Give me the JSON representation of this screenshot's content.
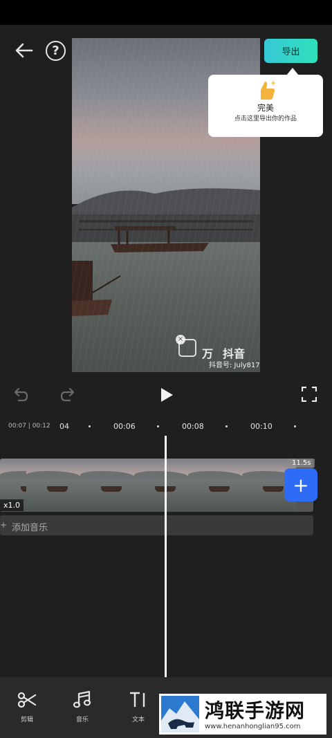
{
  "header": {
    "export_label": "导出",
    "tooltip_title": "完美",
    "tooltip_subtitle": "点击这里导出你的作品"
  },
  "preview": {
    "watermark_brand": "万",
    "watermark_logo": "抖音",
    "watermark_id": "抖音号: July817"
  },
  "ruler": {
    "time_readout": "00:07 | 00:12",
    "partial_tick": "04",
    "ticks": [
      "00:06",
      "00:08",
      "00:10"
    ]
  },
  "timeline": {
    "clip_speed": "x1.0",
    "clip_duration": "11.5s",
    "add_music_label": "添加音乐",
    "add_music_plus": "+"
  },
  "toolbar": {
    "tools": [
      {
        "label": "剪辑",
        "icon": "cut-icon"
      },
      {
        "label": "音乐",
        "icon": "music-icon"
      },
      {
        "label": "文本",
        "icon": "text-icon"
      }
    ]
  },
  "ad": {
    "title": "鸿联手游网",
    "url": "www.henanhonglian95.com"
  },
  "colors": {
    "accent": "#37c9d7",
    "add_button": "#2f6cf6",
    "background": "#1f1f1f"
  }
}
